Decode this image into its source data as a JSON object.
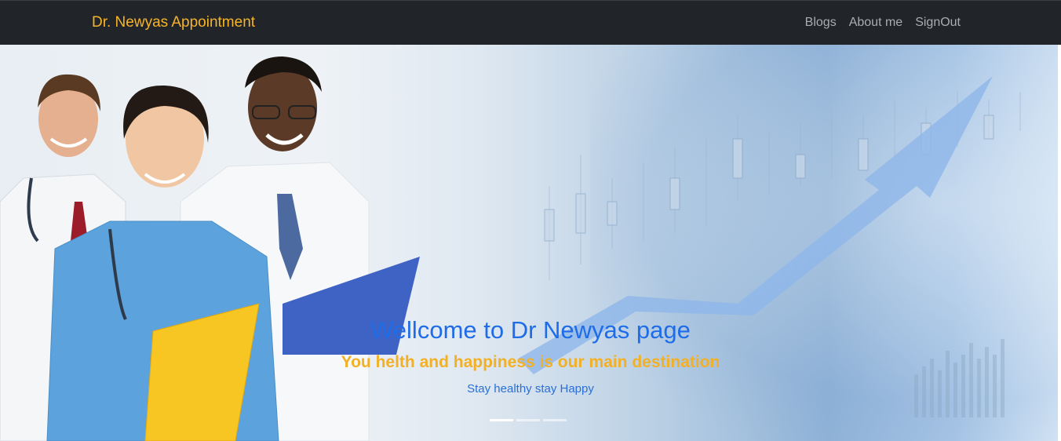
{
  "navbar": {
    "brand": "Dr. Newyas Appointment",
    "links": [
      {
        "label": "Blogs"
      },
      {
        "label": "About me"
      },
      {
        "label": "SignOut"
      }
    ]
  },
  "carousel": {
    "title": "Wellcome to Dr Newyas page",
    "subtitle": "You helth and happiness is our main destination",
    "tagline": "Stay healthy stay Happy",
    "indicators": [
      {
        "active": true
      },
      {
        "active": false
      },
      {
        "active": false
      }
    ]
  },
  "colors": {
    "navbar_bg": "#212529",
    "brand": "#f6b42a",
    "title": "#1e6ce8",
    "subtitle": "#f2b027"
  }
}
